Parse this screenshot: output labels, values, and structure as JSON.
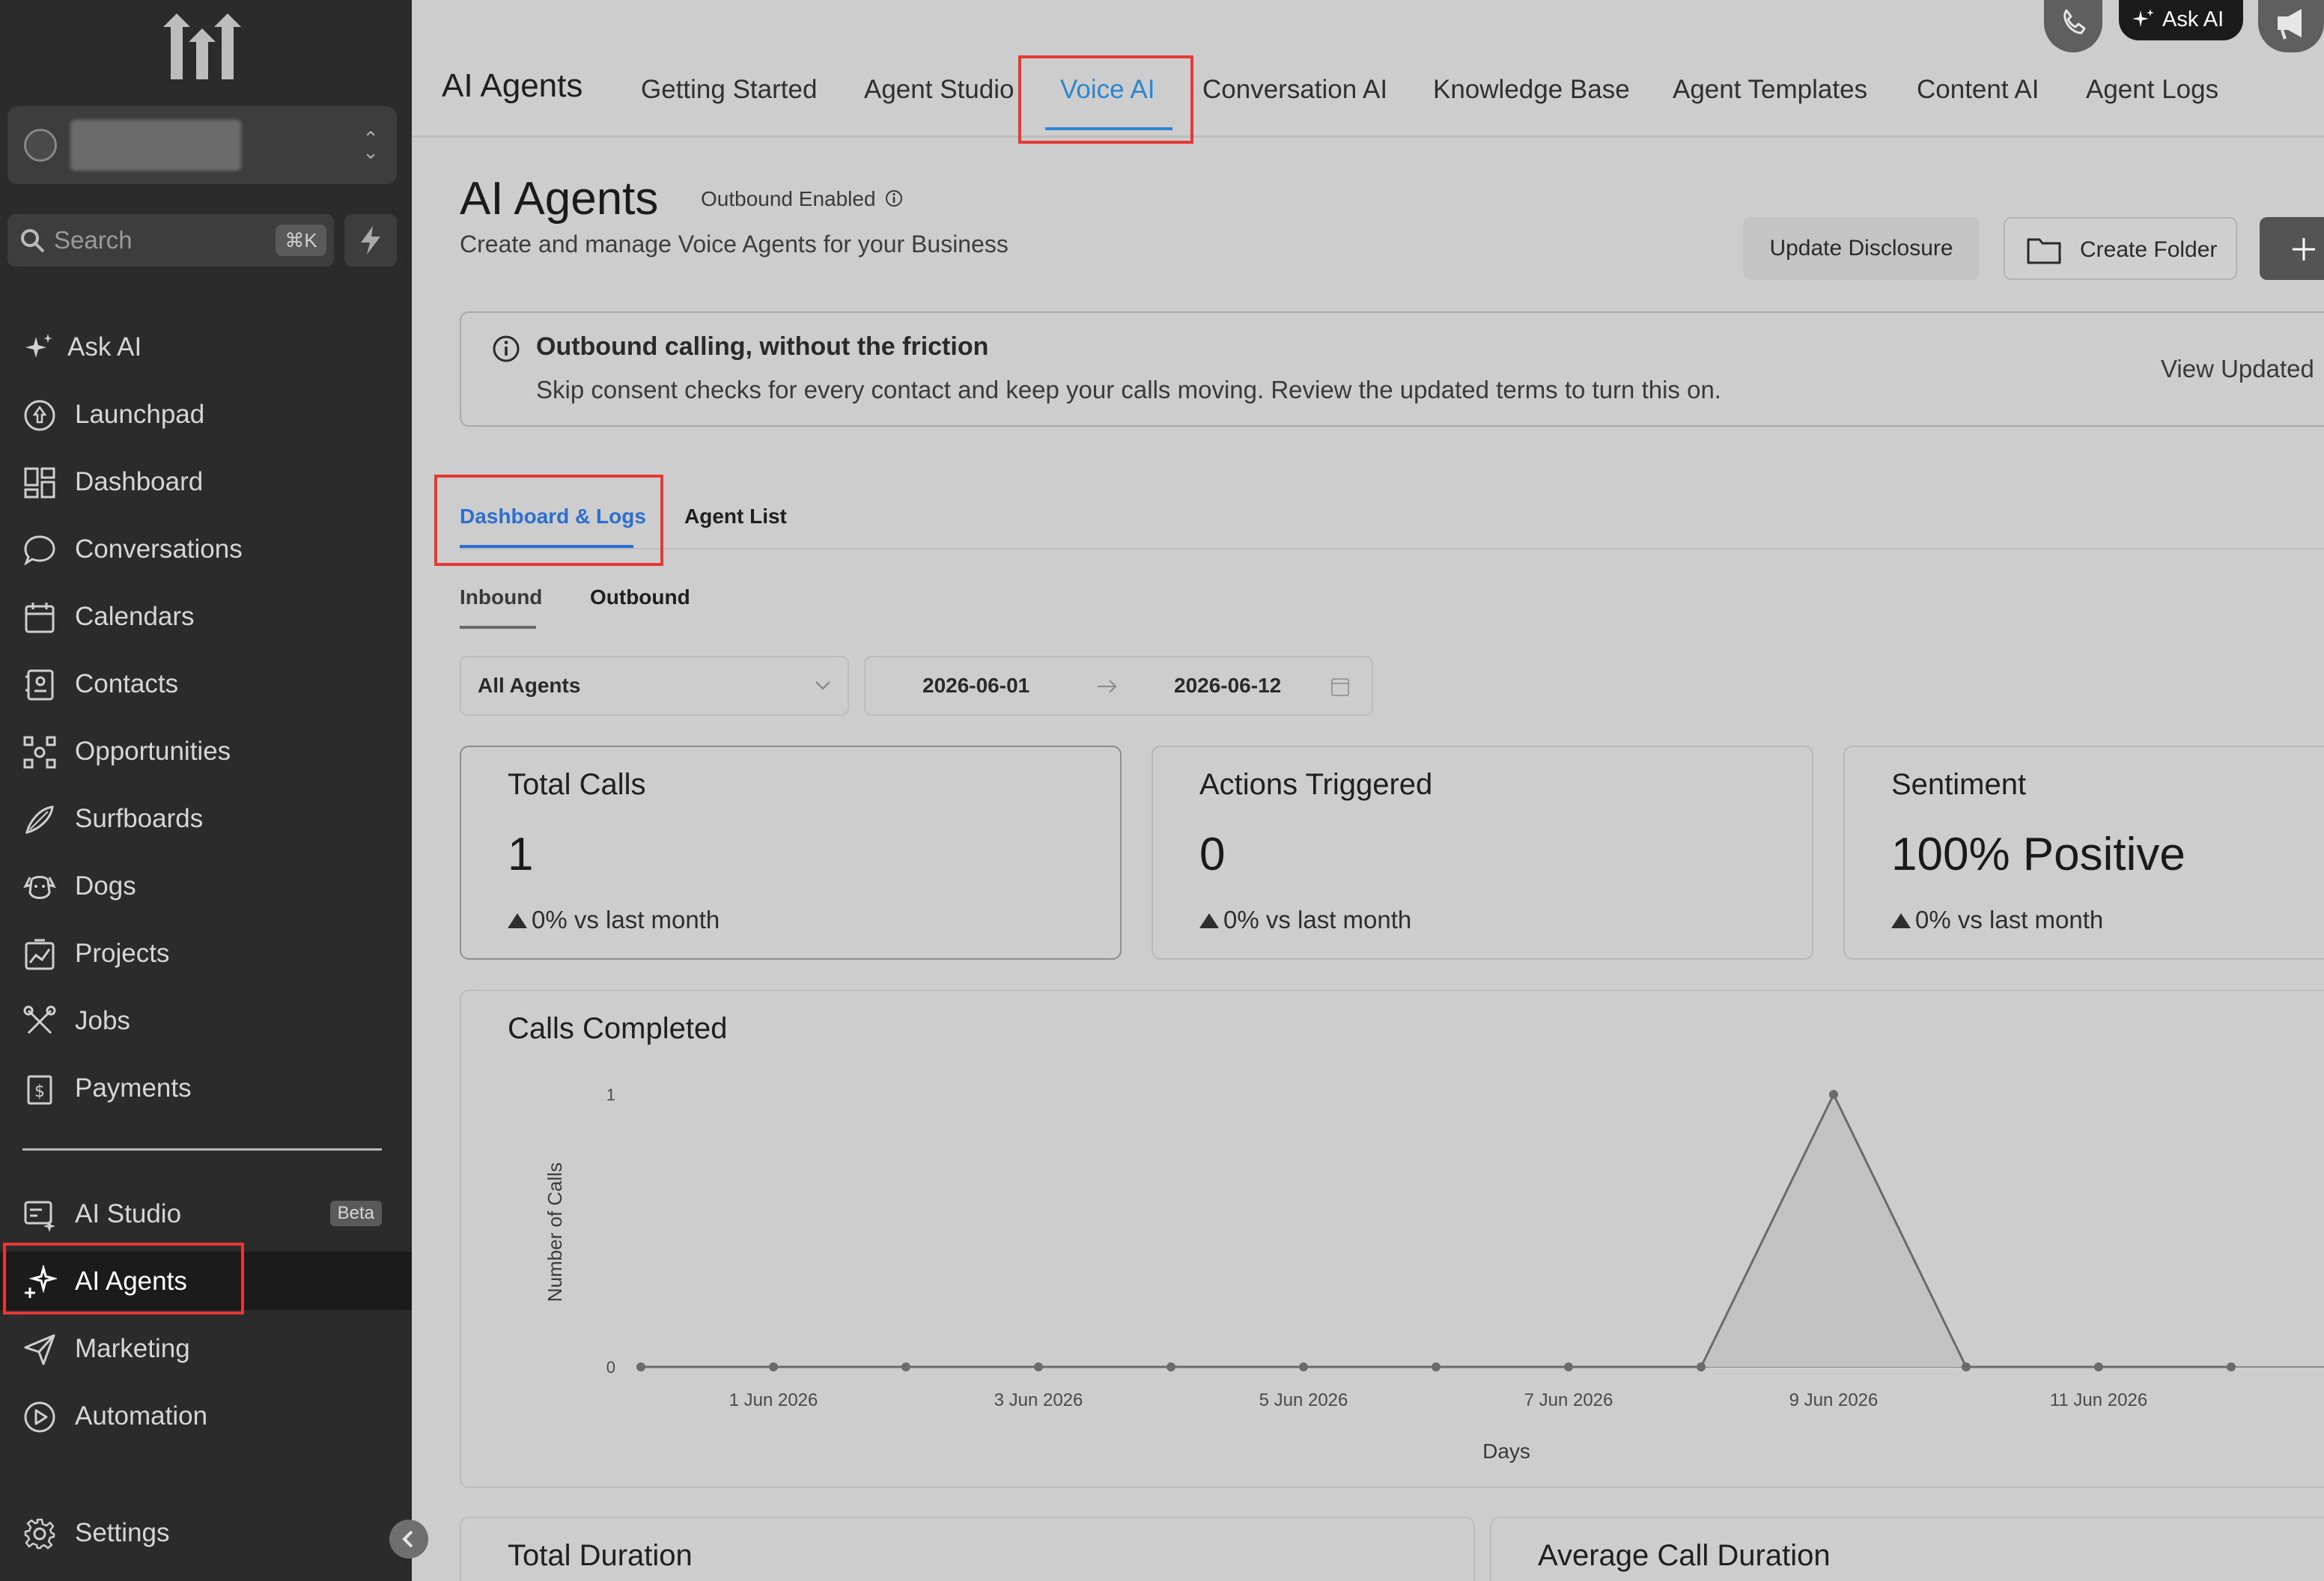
{
  "sidebar": {
    "search_placeholder": "Search",
    "search_shortcut": "⌘K",
    "items": [
      {
        "label": "Ask AI",
        "icon": "sparkle-icon"
      },
      {
        "label": "Launchpad",
        "icon": "launchpad-icon"
      },
      {
        "label": "Dashboard",
        "icon": "dashboard-icon"
      },
      {
        "label": "Conversations",
        "icon": "chat-bubble-icon"
      },
      {
        "label": "Calendars",
        "icon": "calendar-icon"
      },
      {
        "label": "Contacts",
        "icon": "contacts-icon"
      },
      {
        "label": "Opportunities",
        "icon": "opportunities-icon"
      },
      {
        "label": "Surfboards",
        "icon": "surfboard-icon"
      },
      {
        "label": "Dogs",
        "icon": "dog-icon"
      },
      {
        "label": "Projects",
        "icon": "projects-icon"
      },
      {
        "label": "Jobs",
        "icon": "tools-icon"
      },
      {
        "label": "Payments",
        "icon": "payments-icon"
      }
    ],
    "ai_studio": {
      "label": "AI Studio",
      "badge": "Beta"
    },
    "ai_agents": {
      "label": "AI Agents"
    },
    "marketing": {
      "label": "Marketing"
    },
    "automation": {
      "label": "Automation"
    },
    "settings": {
      "label": "Settings"
    }
  },
  "topbar": {
    "title": "AI Agents",
    "tabs": [
      "Getting Started",
      "Agent Studio",
      "Voice AI",
      "Conversation AI",
      "Knowledge Base",
      "Agent Templates",
      "Content AI",
      "Agent Logs"
    ],
    "active_tab": "Voice AI",
    "ask_ai": "Ask AI"
  },
  "page": {
    "title": "AI Agents",
    "badge": "Outbound Enabled",
    "subtitle": "Create and manage Voice Agents for your Business",
    "update_disclosure": "Update Disclosure",
    "create_folder": "Create Folder"
  },
  "banner": {
    "title": "Outbound calling, without the friction",
    "body": "Skip consent checks for every contact and keep your calls moving. Review the updated terms to turn this on.",
    "link": "View Updated"
  },
  "tabs": {
    "dashboard": "Dashboard & Logs",
    "agent_list": "Agent List"
  },
  "subtabs": {
    "inbound": "Inbound",
    "outbound": "Outbound"
  },
  "filters": {
    "agent": "All Agents",
    "start_date": "2026-06-01",
    "end_date": "2026-06-12"
  },
  "cards": [
    {
      "title": "Total Calls",
      "value": "1",
      "delta": "0% vs last month"
    },
    {
      "title": "Actions Triggered",
      "value": "0",
      "delta": "0% vs last month"
    },
    {
      "title": "Sentiment",
      "value": "100% Positive",
      "delta": "0% vs last month"
    }
  ],
  "chart_data": {
    "type": "area",
    "title": "Calls Completed",
    "xlabel": "Days",
    "ylabel": "Number of Calls",
    "ylim": [
      0,
      1
    ],
    "yticks": [
      "0",
      "1"
    ],
    "x": [
      "31 May 2026",
      "1 Jun 2026",
      "2 Jun 2026",
      "3 Jun 2026",
      "4 Jun 2026",
      "5 Jun 2026",
      "6 Jun 2026",
      "7 Jun 2026",
      "8 Jun 2026",
      "9 Jun 2026",
      "10 Jun 2026",
      "11 Jun 2026",
      "12 Jun 2026"
    ],
    "tick_labels": [
      "1 Jun 2026",
      "3 Jun 2026",
      "5 Jun 2026",
      "7 Jun 2026",
      "9 Jun 2026",
      "11 Jun 2026"
    ],
    "series": [
      {
        "values": [
          0,
          0,
          0,
          0,
          0,
          0,
          0,
          0,
          0,
          1,
          0,
          0,
          0
        ]
      }
    ],
    "line_color": "#6b6b6b",
    "fill_color": "#c2c2c2"
  },
  "bottom_cards": {
    "total_duration": "Total Duration",
    "average_call_duration": "Average Call Duration"
  }
}
